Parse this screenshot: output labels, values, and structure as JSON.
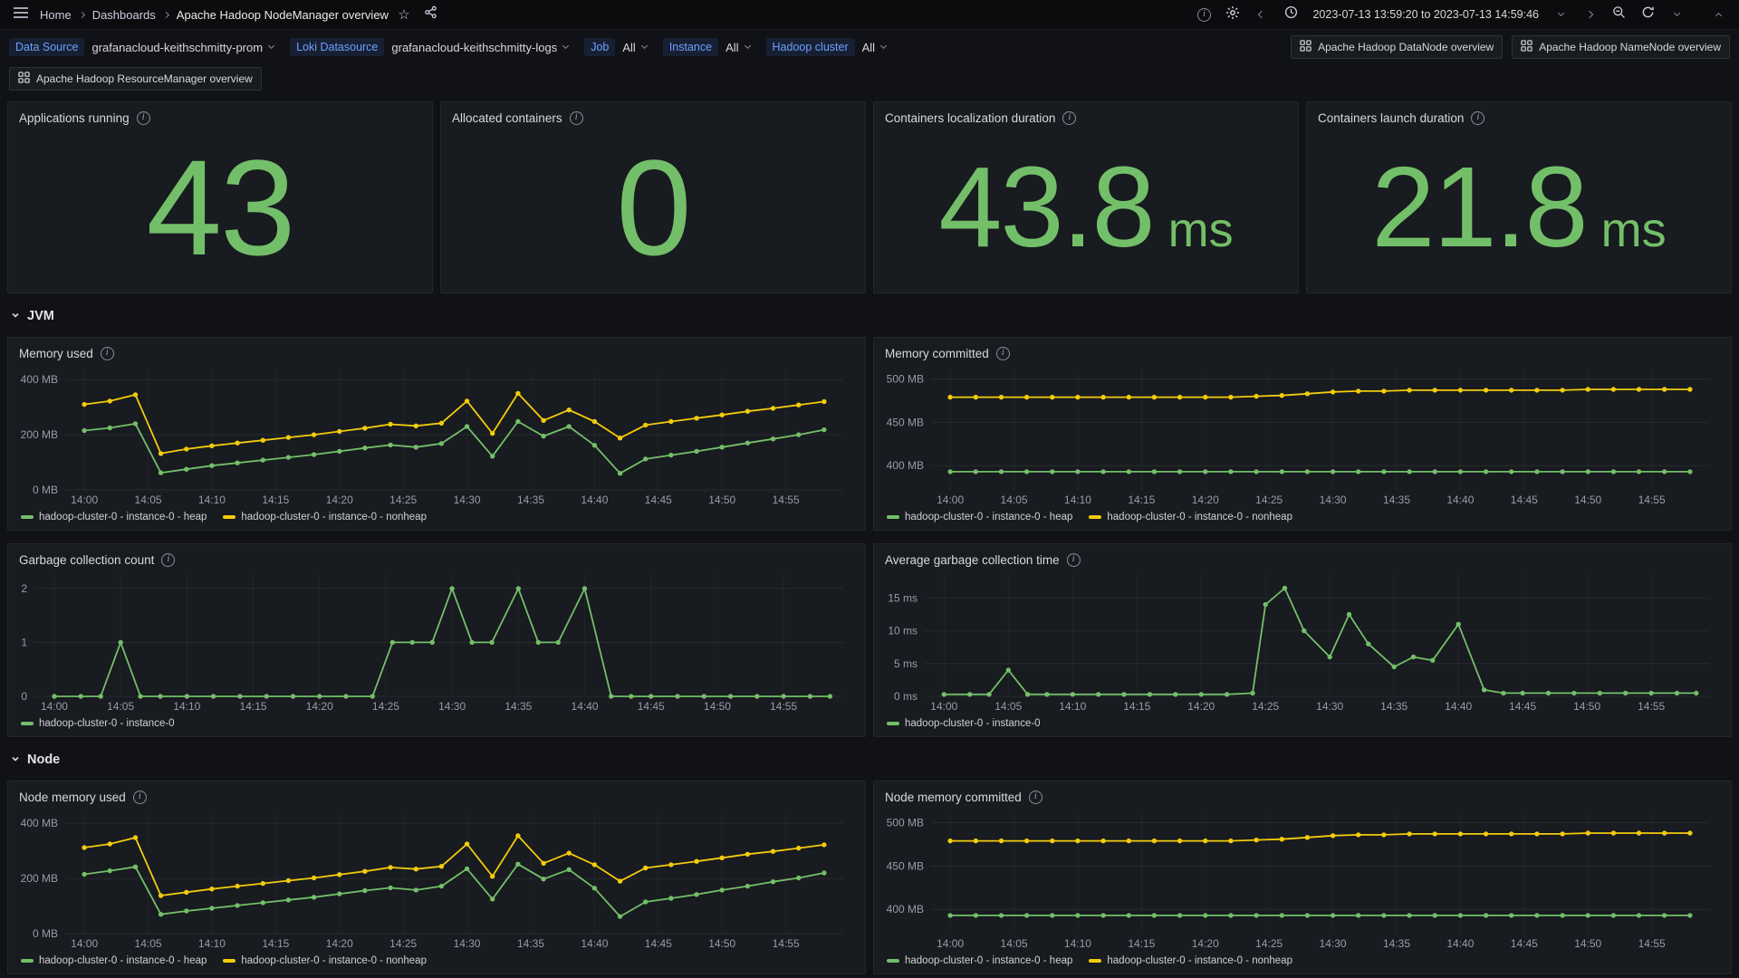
{
  "nav": {
    "breadcrumb": {
      "home": "Home",
      "dashboards": "Dashboards",
      "current": "Apache Hadoop NodeManager overview"
    },
    "time_range": "2023-07-13 13:59:20 to 2023-07-13 14:59:46"
  },
  "icons": {
    "star": "☆"
  },
  "variables": [
    {
      "label": "Data Source",
      "value": "grafanacloud-keithschmitty-prom"
    },
    {
      "label": "Loki Datasource",
      "value": "grafanacloud-keithschmitty-logs"
    },
    {
      "label": "Job",
      "value": "All"
    },
    {
      "label": "Instance",
      "value": "All"
    },
    {
      "label": "Hadoop cluster",
      "value": "All"
    }
  ],
  "links": [
    {
      "label": "Apache Hadoop DataNode overview"
    },
    {
      "label": "Apache Hadoop NameNode overview"
    },
    {
      "label": "Apache Hadoop ResourceManager overview"
    }
  ],
  "sections": {
    "jvm": "JVM",
    "node": "Node"
  },
  "stats": [
    {
      "title": "Applications running",
      "value": "43",
      "unit": ""
    },
    {
      "title": "Allocated containers",
      "value": "0",
      "unit": ""
    },
    {
      "title": "Containers localization duration",
      "value": "43.8",
      "unit": "ms"
    },
    {
      "title": "Containers launch duration",
      "value": "21.8",
      "unit": "ms"
    }
  ],
  "colors": {
    "green": "#73bf69",
    "yellow": "#f2cc0c",
    "blue": "#6e9fff"
  },
  "time_axis": [
    {
      "v": 0,
      "label": "14:00"
    },
    {
      "v": 5,
      "label": "14:05"
    },
    {
      "v": 10,
      "label": "14:10"
    },
    {
      "v": 15,
      "label": "14:15"
    },
    {
      "v": 20,
      "label": "14:20"
    },
    {
      "v": 25,
      "label": "14:25"
    },
    {
      "v": 30,
      "label": "14:30"
    },
    {
      "v": 35,
      "label": "14:35"
    },
    {
      "v": 40,
      "label": "14:40"
    },
    {
      "v": 45,
      "label": "14:45"
    },
    {
      "v": 50,
      "label": "14:50"
    },
    {
      "v": 55,
      "label": "14:55"
    }
  ],
  "chart_data": [
    {
      "type": "line",
      "title": "Memory used",
      "xlabel": "",
      "ylabel": "",
      "xlim": [
        -1.5,
        59.5
      ],
      "ylim": [
        0,
        440
      ],
      "grid": true,
      "legend_position": "bottom",
      "y_ticks": [
        {
          "v": 0,
          "label": "0 MB"
        },
        {
          "v": 200,
          "label": "200 MB"
        },
        {
          "v": 400,
          "label": "400 MB"
        }
      ],
      "series": [
        {
          "name": "hadoop-cluster-0 - instance-0 - heap",
          "color": "#73bf69",
          "x": [
            0,
            2,
            4,
            6,
            8,
            10,
            12,
            14,
            16,
            18,
            20,
            22,
            24,
            26,
            28,
            30,
            32,
            34,
            36,
            38,
            40,
            42,
            44,
            46,
            48,
            50,
            52,
            54,
            56,
            58
          ],
          "y": [
            215,
            225,
            240,
            62,
            75,
            88,
            98,
            108,
            118,
            128,
            140,
            152,
            163,
            155,
            168,
            230,
            122,
            248,
            195,
            230,
            162,
            60,
            112,
            126,
            140,
            155,
            170,
            185,
            200,
            218
          ]
        },
        {
          "name": "hadoop-cluster-0 - instance-0 - nonheap",
          "color": "#f2cc0c",
          "x": [
            0,
            2,
            4,
            6,
            8,
            10,
            12,
            14,
            16,
            18,
            20,
            22,
            24,
            26,
            28,
            30,
            32,
            34,
            36,
            38,
            40,
            42,
            44,
            46,
            48,
            50,
            52,
            54,
            56,
            58
          ],
          "y": [
            310,
            322,
            345,
            132,
            148,
            160,
            170,
            180,
            190,
            200,
            212,
            224,
            238,
            232,
            242,
            322,
            205,
            350,
            252,
            290,
            248,
            188,
            235,
            248,
            260,
            272,
            285,
            296,
            308,
            320
          ]
        }
      ]
    },
    {
      "type": "line",
      "title": "Memory committed",
      "xlabel": "",
      "ylabel": "",
      "xlim": [
        -1.5,
        59.5
      ],
      "ylim": [
        372,
        512
      ],
      "grid": true,
      "legend_position": "bottom",
      "y_ticks": [
        {
          "v": 400,
          "label": "400 MB"
        },
        {
          "v": 450,
          "label": "450 MB"
        },
        {
          "v": 500,
          "label": "500 MB"
        }
      ],
      "series": [
        {
          "name": "hadoop-cluster-0 - instance-0 - heap",
          "color": "#73bf69",
          "x": [
            0,
            2,
            4,
            6,
            8,
            10,
            12,
            14,
            16,
            18,
            20,
            22,
            24,
            26,
            28,
            30,
            32,
            34,
            36,
            38,
            40,
            42,
            44,
            46,
            48,
            50,
            52,
            54,
            56,
            58
          ],
          "y": [
            393,
            393,
            393,
            393,
            393,
            393,
            393,
            393,
            393,
            393,
            393,
            393,
            393,
            393,
            393,
            393,
            393,
            393,
            393,
            393,
            393,
            393,
            393,
            393,
            393,
            393,
            393,
            393,
            393,
            393
          ]
        },
        {
          "name": "hadoop-cluster-0 - instance-0 - nonheap",
          "color": "#f2cc0c",
          "x": [
            0,
            2,
            4,
            6,
            8,
            10,
            12,
            14,
            16,
            18,
            20,
            22,
            24,
            26,
            28,
            30,
            32,
            34,
            36,
            38,
            40,
            42,
            44,
            46,
            48,
            50,
            52,
            54,
            56,
            58
          ],
          "y": [
            479,
            479,
            479,
            479,
            479,
            479,
            479,
            479,
            479,
            479,
            479,
            479,
            480,
            481,
            483,
            485,
            486,
            486,
            487,
            487,
            487,
            487,
            487,
            487,
            487,
            488,
            488,
            488,
            488,
            488
          ]
        }
      ]
    },
    {
      "type": "line",
      "title": "Garbage collection count",
      "xlabel": "",
      "ylabel": "",
      "xlim": [
        -1.5,
        59.5
      ],
      "ylim": [
        0,
        2.25
      ],
      "grid": true,
      "legend_position": "bottom",
      "y_ticks": [
        {
          "v": 0,
          "label": "0"
        },
        {
          "v": 1,
          "label": "1"
        },
        {
          "v": 2,
          "label": "2"
        }
      ],
      "series": [
        {
          "name": "hadoop-cluster-0 - instance-0",
          "color": "#73bf69",
          "x": [
            0,
            2,
            3.5,
            5,
            6.5,
            8,
            10,
            12,
            14,
            16,
            18,
            20,
            22,
            24,
            25.5,
            27,
            28.5,
            30,
            31.5,
            33,
            35,
            36.5,
            38,
            40,
            42,
            43.5,
            45,
            47,
            49,
            51,
            53,
            55,
            57,
            58.5
          ],
          "y": [
            0,
            0,
            0,
            1,
            0,
            0,
            0,
            0,
            0,
            0,
            0,
            0,
            0,
            0,
            1,
            1,
            1,
            2,
            1,
            1,
            2,
            1,
            1,
            2,
            0,
            0,
            0,
            0,
            0,
            0,
            0,
            0,
            0,
            0
          ]
        }
      ]
    },
    {
      "type": "line",
      "title": "Average garbage collection time",
      "xlabel": "",
      "ylabel": "",
      "xlim": [
        -1.5,
        59.5
      ],
      "ylim": [
        0,
        18.5
      ],
      "grid": true,
      "legend_position": "bottom",
      "y_ticks": [
        {
          "v": 0,
          "label": "0 ms"
        },
        {
          "v": 5,
          "label": "5 ms"
        },
        {
          "v": 10,
          "label": "10 ms"
        },
        {
          "v": 15,
          "label": "15 ms"
        }
      ],
      "series": [
        {
          "name": "hadoop-cluster-0 - instance-0",
          "color": "#73bf69",
          "x": [
            0,
            2,
            3.5,
            5,
            6.5,
            8,
            10,
            12,
            14,
            16,
            18,
            20,
            22,
            24,
            25,
            26.5,
            28,
            30,
            31.5,
            33,
            35,
            36.5,
            38,
            40,
            42,
            43.5,
            45,
            47,
            49,
            51,
            53,
            55,
            57,
            58.5
          ],
          "y": [
            0.3,
            0.3,
            0.3,
            4,
            0.3,
            0.3,
            0.3,
            0.3,
            0.3,
            0.3,
            0.3,
            0.3,
            0.3,
            0.5,
            14,
            16.5,
            10,
            6,
            12.5,
            8,
            4.5,
            6,
            5.5,
            11,
            1,
            0.5,
            0.5,
            0.5,
            0.5,
            0.5,
            0.5,
            0.5,
            0.5,
            0.5
          ]
        }
      ]
    },
    {
      "type": "line",
      "title": "Node memory used",
      "xlabel": "",
      "ylabel": "",
      "xlim": [
        -1.5,
        59.5
      ],
      "ylim": [
        0,
        440
      ],
      "grid": true,
      "legend_position": "bottom",
      "y_ticks": [
        {
          "v": 0,
          "label": "0 MB"
        },
        {
          "v": 200,
          "label": "200 MB"
        },
        {
          "v": 400,
          "label": "400 MB"
        }
      ],
      "series": [
        {
          "name": "hadoop-cluster-0 - instance-0 - heap",
          "color": "#73bf69",
          "x": [
            0,
            2,
            4,
            6,
            8,
            10,
            12,
            14,
            16,
            18,
            20,
            22,
            24,
            26,
            28,
            30,
            32,
            34,
            36,
            38,
            40,
            42,
            44,
            46,
            48,
            50,
            52,
            54,
            56,
            58
          ],
          "y": [
            215,
            228,
            242,
            70,
            82,
            92,
            102,
            112,
            122,
            132,
            144,
            156,
            166,
            158,
            172,
            235,
            125,
            252,
            198,
            232,
            165,
            62,
            115,
            128,
            142,
            158,
            172,
            188,
            202,
            220
          ]
        },
        {
          "name": "hadoop-cluster-0 - instance-0 - nonheap",
          "color": "#f2cc0c",
          "x": [
            0,
            2,
            4,
            6,
            8,
            10,
            12,
            14,
            16,
            18,
            20,
            22,
            24,
            26,
            28,
            30,
            32,
            34,
            36,
            38,
            40,
            42,
            44,
            46,
            48,
            50,
            52,
            54,
            56,
            58
          ],
          "y": [
            312,
            325,
            348,
            138,
            150,
            162,
            172,
            182,
            192,
            202,
            214,
            226,
            240,
            234,
            244,
            325,
            208,
            355,
            255,
            292,
            250,
            190,
            238,
            250,
            262,
            275,
            288,
            298,
            310,
            322
          ]
        }
      ]
    },
    {
      "type": "line",
      "title": "Node memory committed",
      "xlabel": "",
      "ylabel": "",
      "xlim": [
        -1.5,
        59.5
      ],
      "ylim": [
        372,
        512
      ],
      "grid": true,
      "legend_position": "bottom",
      "y_ticks": [
        {
          "v": 400,
          "label": "400 MB"
        },
        {
          "v": 450,
          "label": "450 MB"
        },
        {
          "v": 500,
          "label": "500 MB"
        }
      ],
      "series": [
        {
          "name": "hadoop-cluster-0 - instance-0 - heap",
          "color": "#73bf69",
          "x": [
            0,
            2,
            4,
            6,
            8,
            10,
            12,
            14,
            16,
            18,
            20,
            22,
            24,
            26,
            28,
            30,
            32,
            34,
            36,
            38,
            40,
            42,
            44,
            46,
            48,
            50,
            52,
            54,
            56,
            58
          ],
          "y": [
            393,
            393,
            393,
            393,
            393,
            393,
            393,
            393,
            393,
            393,
            393,
            393,
            393,
            393,
            393,
            393,
            393,
            393,
            393,
            393,
            393,
            393,
            393,
            393,
            393,
            393,
            393,
            393,
            393,
            393
          ]
        },
        {
          "name": "hadoop-cluster-0 - instance-0 - nonheap",
          "color": "#f2cc0c",
          "x": [
            0,
            2,
            4,
            6,
            8,
            10,
            12,
            14,
            16,
            18,
            20,
            22,
            24,
            26,
            28,
            30,
            32,
            34,
            36,
            38,
            40,
            42,
            44,
            46,
            48,
            50,
            52,
            54,
            56,
            58
          ],
          "y": [
            479,
            479,
            479,
            479,
            479,
            479,
            479,
            479,
            479,
            479,
            479,
            479,
            480,
            481,
            483,
            485,
            486,
            486,
            487,
            487,
            487,
            487,
            487,
            487,
            487,
            488,
            488,
            488,
            488,
            488
          ]
        }
      ]
    }
  ]
}
